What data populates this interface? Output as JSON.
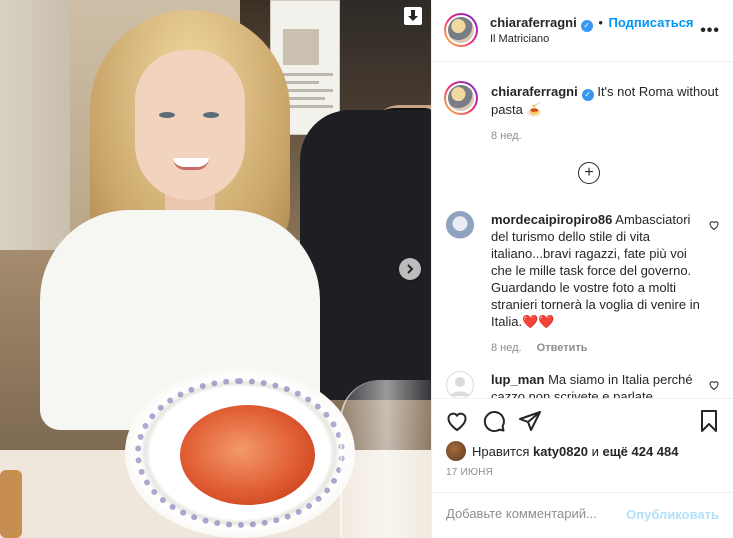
{
  "post": {
    "author": "chiaraferragni",
    "follow_label": "Подписаться",
    "location": "Il Matriciano",
    "more_label": "•••",
    "caption_text": "It's not Roma without pasta 🍝",
    "caption_time": "8 нед."
  },
  "comments": [
    {
      "user": "mordecaipiropiro86",
      "text": "Ambasciatori del turismo dello stile di vita italiano...bravi ragazzi, fate più voi che le mille task force del governo. Guardando le vostre foto a molti stranieri tornerà la voglia di venire in Italia.❤️❤️",
      "time": "8 нед.",
      "reply_label": "Ответить"
    },
    {
      "user": "lup_man",
      "text": "Ma siamo in Italia perché cazzo non scrivete e parlate",
      "time": "",
      "reply_label": ""
    }
  ],
  "likes": {
    "prefix": "Нравится",
    "user": "katy0820",
    "middle": "и",
    "others": "ещё 424 484"
  },
  "date": "17 ИЮНЯ",
  "add_comment": {
    "placeholder": "Добавьте комментарий...",
    "publish_label": "Опубликовать"
  },
  "icons": {
    "verified": "verified-badge-icon",
    "download": "download-arrow-icon",
    "next": "chevron-right-icon",
    "add": "plus-circle-icon",
    "like": "heart-icon",
    "comment": "comment-bubble-icon",
    "share": "paper-plane-icon",
    "save": "bookmark-icon"
  },
  "colors": {
    "link_blue": "#0095f6",
    "verified_blue": "#3897f0",
    "muted": "#8e8e8e",
    "publish_disabled": "#b2dffc"
  }
}
